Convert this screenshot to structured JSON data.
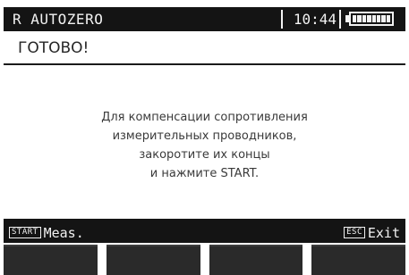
{
  "header": {
    "title": "R AUTOZERO",
    "time": "10:44",
    "battery_level": 1.0
  },
  "status": {
    "text": "ГОТОВО!"
  },
  "message": {
    "lines": [
      "Для компенсации сопротивления",
      "измерительных проводников,",
      "закоротите их концы",
      "и нажмите START."
    ]
  },
  "footer": {
    "left_key": "START",
    "left_label": "Meas.",
    "right_key": "ESC",
    "right_label": "Exit"
  },
  "colors": {
    "bar_background": "#141414",
    "bar_text": "#f2f2f2",
    "screen_background": "#ffffff",
    "softkey": "#2a2a2a"
  }
}
